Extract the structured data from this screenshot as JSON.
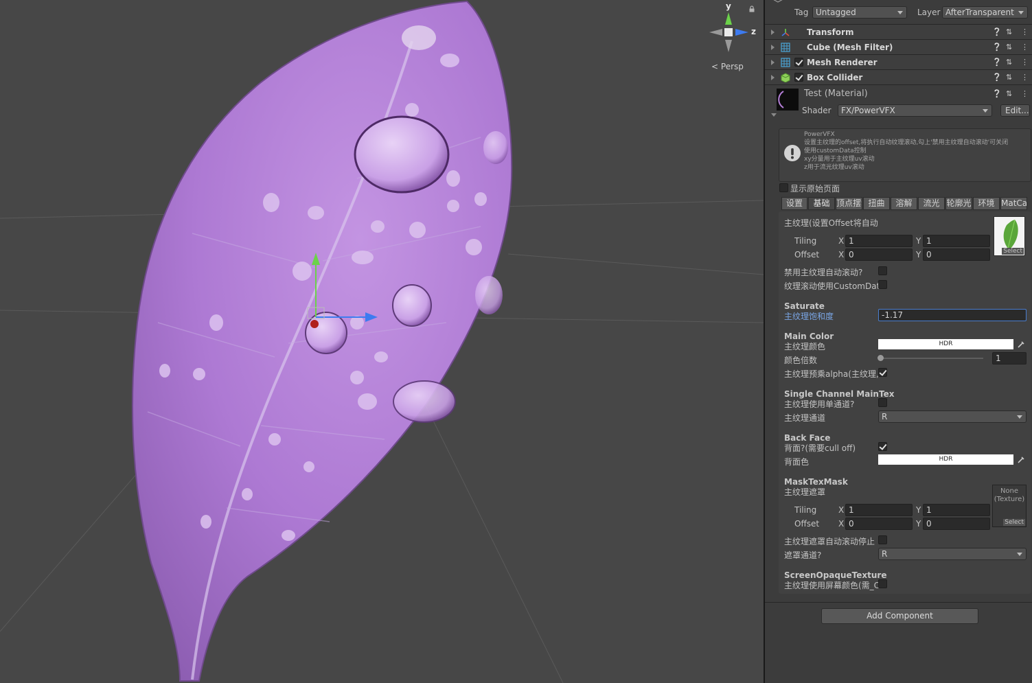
{
  "scene": {
    "persp_label": "Persp",
    "axes": {
      "y": "y",
      "z": "z"
    }
  },
  "header": {
    "tag_label": "Tag",
    "tag_value": "Untagged",
    "layer_label": "Layer",
    "layer_value": "AfterTransparent"
  },
  "components": [
    {
      "name": "Transform"
    },
    {
      "name": "Cube (Mesh Filter)"
    },
    {
      "name": "Mesh Renderer",
      "enabled": true
    },
    {
      "name": "Box Collider",
      "enabled": true
    }
  ],
  "material": {
    "name": "Test (Material)",
    "shader_label": "Shader",
    "shader_value": "FX/PowerVFX",
    "edit_label": "Edit..."
  },
  "help_box": {
    "lines": [
      "PowerVFX",
      "设置主纹理的offset,将执行自动纹理滚动,勾上'禁用主纹理自动滚动'可关闭",
      "使用customData控制",
      "xy分量用于主纹理uv滚动",
      "z用于流光纹理uv滚动"
    ]
  },
  "show_original": {
    "label": "显示原始页面",
    "checked": false
  },
  "tabs": [
    "设置",
    "基础",
    "顶点摆动",
    "扭曲",
    "溶解",
    "流光",
    "轮廓光",
    "环境",
    "MatCap"
  ],
  "tab_display": [
    "设置",
    "基础",
    "顶点摆动",
    "扭曲",
    "溶解",
    "流光",
    "轮廓光",
    "环境",
    "MatCap"
  ],
  "active_tab": "基础",
  "main_tex": {
    "label": "主纹理(设置Offset将自动",
    "tiling_label": "Tiling",
    "offset_label": "Offset",
    "tiling_x": "1",
    "tiling_y": "1",
    "offset_x": "0",
    "offset_y": "0",
    "x_label": "X",
    "y_label": "Y",
    "select_label": "Select"
  },
  "toggles": {
    "disable_scroll": {
      "label": "禁用主纹理自动滚动?",
      "checked": false
    },
    "scroll_custom": {
      "label": "纹理滚动使用CustomDat",
      "checked": false
    }
  },
  "saturate": {
    "title": "Saturate",
    "label": "主纹理饱和度",
    "value": "-1.17"
  },
  "main_color": {
    "title": "Main Color",
    "label": "主纹理颜色",
    "hdr": "HDR",
    "multiplier_label": "颜色倍数",
    "multiplier_value": "1",
    "multiplier_fraction": 0.0,
    "premultiply_label": "主纹理预乘alpha(主纹理,",
    "premultiply_checked": true
  },
  "single_channel": {
    "title": "Single Channel MainTex",
    "use_label": "主纹理使用单通道?",
    "use_checked": false,
    "channel_label": "主纹理通道",
    "channel_value": "R"
  },
  "back_face": {
    "title": "Back Face",
    "label": "背面?(需要cull off)",
    "checked": true,
    "color_label": "背面色",
    "hdr": "HDR"
  },
  "mask": {
    "title": "MaskTexMask",
    "label": "主纹理遮罩",
    "tiling_label": "Tiling",
    "offset_label": "Offset",
    "tiling_x": "1",
    "tiling_y": "1",
    "offset_x": "0",
    "offset_y": "0",
    "none_text": "None\n(Texture)",
    "select_label": "Select",
    "auto_stop_label": "主纹理遮罩自动滚动停止",
    "auto_stop_checked": false,
    "channel_label": "遮罩通道?",
    "channel_value": "R"
  },
  "screen_opaque": {
    "title": "ScreenOpaqueTexture",
    "label": "主纹理使用屏幕颜色(需_C",
    "checked": false
  },
  "add_component": "Add Component",
  "colors": {
    "leaf": "#b57fd8",
    "leaf_dark": "#8a5cab",
    "accent_blue": "#7aa6e6",
    "gizmo_y": "#6cd24a",
    "gizmo_x": "#3d7bf0",
    "gizmo_origin": "#b0201c"
  }
}
